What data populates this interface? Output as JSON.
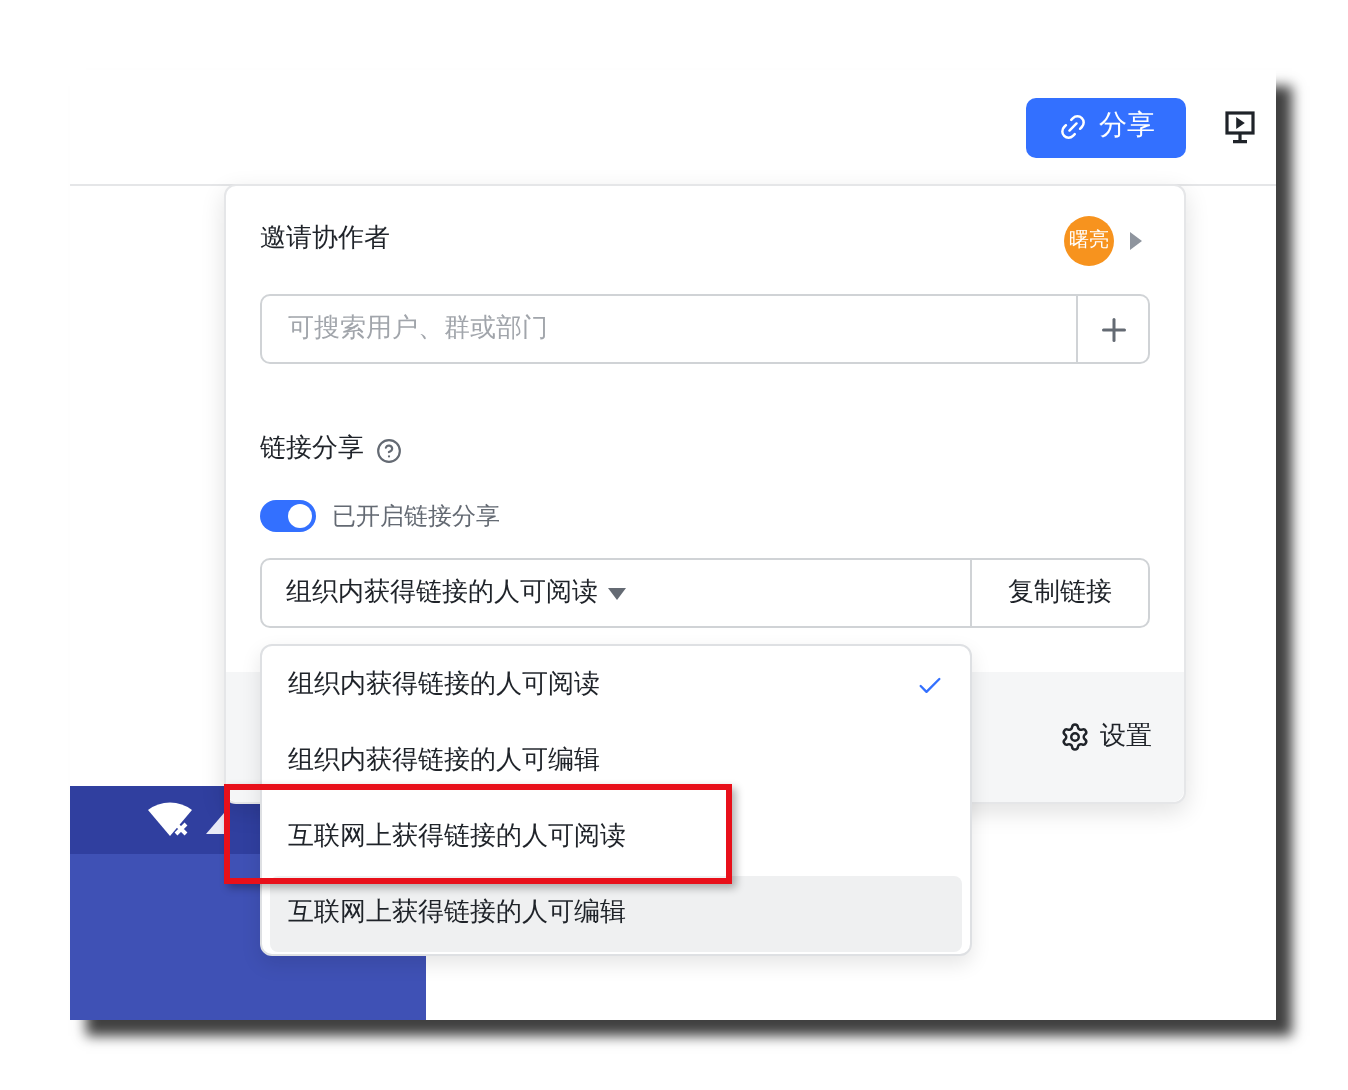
{
  "toolbar": {
    "share_button": "分享"
  },
  "share_panel": {
    "invite_title": "邀请协作者",
    "avatar": "曙亮",
    "search": {
      "placeholder": "可搜索用户、群或部门"
    },
    "link_share_title": "链接分享",
    "link_toggle": {
      "on": true,
      "label": "已开启链接分享"
    },
    "permission_select": {
      "value": "组织内获得链接的人可阅读",
      "expanded": true
    },
    "copy_button": "复制链接",
    "settings_button": "设置"
  },
  "permission_menu": [
    {
      "label": "组织内获得链接的人可阅读",
      "selected": true,
      "hovered": false,
      "annotated": false
    },
    {
      "label": "组织内获得链接的人可编辑",
      "selected": false,
      "hovered": false,
      "annotated": false
    },
    {
      "label": "互联网上获得链接的人可阅读",
      "selected": false,
      "hovered": false,
      "annotated": true
    },
    {
      "label": "互联网上获得链接的人可编辑",
      "selected": false,
      "hovered": true,
      "annotated": false
    }
  ]
}
